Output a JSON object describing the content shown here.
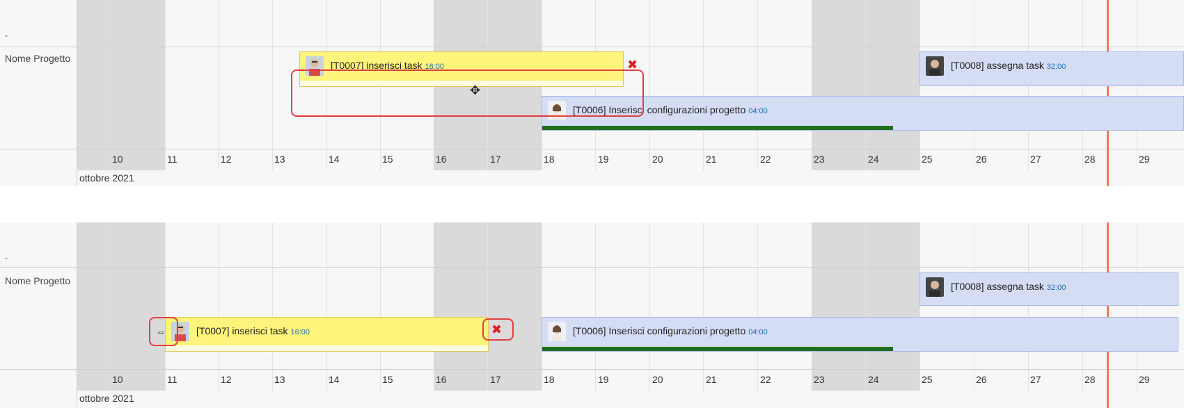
{
  "gantt": {
    "row_dash": "-",
    "project_name": "Nome Progetto",
    "month_label": "ottobre 2021",
    "days": [
      "10",
      "11",
      "12",
      "13",
      "14",
      "15",
      "16",
      "17",
      "18",
      "19",
      "20",
      "21",
      "22",
      "23",
      "24",
      "25",
      "26",
      "27",
      "28",
      "29"
    ],
    "colors": {
      "task_yellow": "#fff47c",
      "task_blue": "#d5ddf5",
      "progress": "#216e21",
      "today_line": "#f07a5a",
      "highlight": "#e23f3f"
    }
  },
  "top": {
    "task_t0007": {
      "title": "[T0007] inserisci task",
      "hours": "16:00"
    },
    "task_t0008": {
      "title": "[T0008] assegna task",
      "hours": "32:00"
    },
    "task_t0006": {
      "title": "[T0006] Inserisci configurazioni progetto",
      "hours": "04:00",
      "progress": 0.5
    },
    "delete_icon": "✖",
    "move_icon": "✥"
  },
  "bottom": {
    "task_t0007": {
      "title": "[T0007] inserisci task",
      "hours": "16:00"
    },
    "task_t0008": {
      "title": "[T0008] assegna task",
      "hours": "32:00"
    },
    "task_t0006": {
      "title": "[T0006] Inserisci configurazioni progetto",
      "hours": "04:00",
      "progress": 0.5
    },
    "delete_icon": "✖",
    "resize_icon": "⇔"
  }
}
